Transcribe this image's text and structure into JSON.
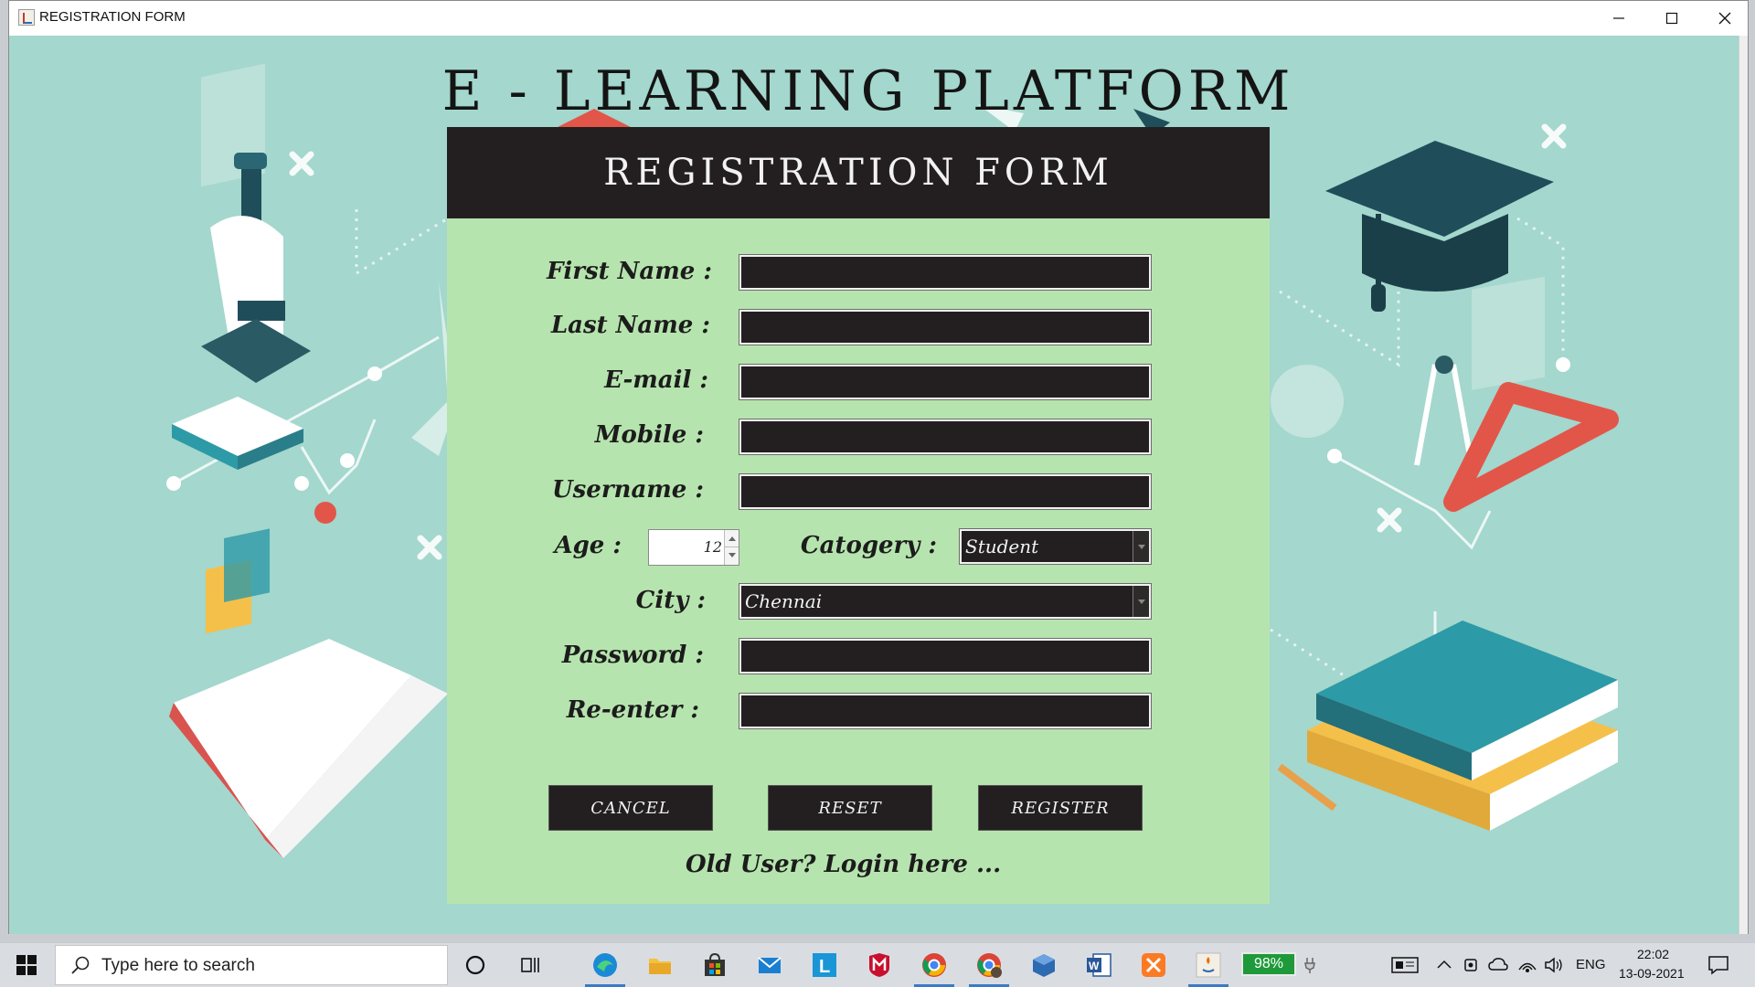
{
  "window": {
    "title": "REGISTRATION FORM"
  },
  "app": {
    "heading": "E - LEARNING PLATFORM",
    "form_title": "REGISTRATION FORM"
  },
  "form": {
    "labels": {
      "first_name": "First Name :",
      "last_name": "Last Name :",
      "email": "E-mail :",
      "mobile": "Mobile :",
      "username": "Username :",
      "age": "Age :",
      "category": "Catogery :",
      "city": "City :",
      "password": "Password :",
      "reenter": "Re-enter :"
    },
    "values": {
      "first_name": "",
      "last_name": "",
      "email": "",
      "mobile": "",
      "username": "",
      "age": "12",
      "category": "Student",
      "city": "Chennai",
      "password": "",
      "reenter": ""
    },
    "buttons": {
      "cancel": "CANCEL",
      "reset": "RESET",
      "register": "REGISTER"
    },
    "login_link": "Old User?  Login here ..."
  },
  "taskbar": {
    "search_placeholder": "Type here to search",
    "battery": "98%",
    "language": "ENG",
    "time": "22:02",
    "date": "13-09-2021"
  },
  "colors": {
    "background": "#a4d7cd",
    "panel": "#b6e4ae",
    "dark": "#231f20"
  }
}
